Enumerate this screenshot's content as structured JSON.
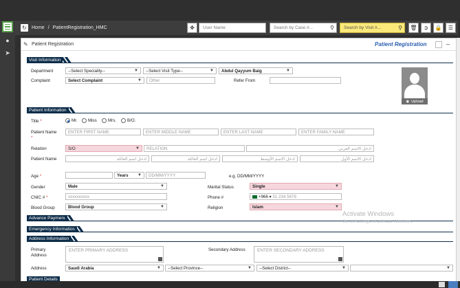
{
  "topbar": {
    "breadcrumb_home": "Home",
    "breadcrumb_sep": "/",
    "breadcrumb_current": "PatientRegistration_HMC",
    "user_name_placeholder": "User Name",
    "search_case_placeholder": "Search by Case #...",
    "search_visit_placeholder": "Search by Visit #..."
  },
  "page": {
    "title": "Patient Registration",
    "title_right": "Patient Registration"
  },
  "sections": {
    "visit": "Visit Information",
    "patient": "Patient Information",
    "advance": "Advance Payment",
    "emergency": "Emergency Information",
    "address": "Address Information",
    "patient_details": "Patient Details"
  },
  "visit": {
    "department_label": "Department",
    "speciality": "--Select Speciality--",
    "visit_type": "--Select Visit Type--",
    "doctor": "Abdul Qayyum Baig",
    "complaint_label": "Complaint",
    "complaint": "Select Complaint",
    "other_placeholder": "Other",
    "refer_label": "Refer From"
  },
  "patient": {
    "title_label": "Title",
    "titles": [
      "Mr.",
      "Miss",
      "Mrs.",
      "B/O."
    ],
    "name_label": "Patient Name",
    "first_ph": "ENTER FIRST NAME",
    "middle_ph": "ENTER MIDDLE NAME",
    "last_ph": "ENTER LAST NAME",
    "family_ph": "ENTER FAMILY NAME",
    "relation_label": "Relation",
    "relation": "S/O",
    "relation_ph": "RELATION",
    "relation_ar_ph": "ادخل الاسم العربي",
    "name_ar_label": "Patient Name",
    "ar_family_ph": "ادخل اسم العائلة",
    "ar_last_ph": "ادخل اسم العائلة",
    "ar_middle_ph": "ادخل الاسم الأوسط",
    "ar_first_ph": "ادخل الاسم الأول",
    "ar_rel_ph": "ادخل اسم العائلة",
    "age_label": "Age",
    "age_unit": "Years",
    "dob_ph": "DD/MM/YYYY",
    "dob_hint": "e.g. DD/MM/YYYY",
    "gender_label": "Gender",
    "gender": "Male",
    "marital_label": "Marital Status",
    "marital": "Single",
    "cnic_label": "CNIC #",
    "cnic_ph": "xxxxxxxxxx",
    "phone_label": "Phone #",
    "phone_code": "+966",
    "phone_ph": "51 234 5678",
    "blood_label": "Blood Group",
    "blood": "Blood Group",
    "religion_label": "Religion",
    "religion": "Islam"
  },
  "address": {
    "primary_label": "Primary Address",
    "primary_ph": "ENTER PRIMARY ADDRESS",
    "secondary_label": "Secondary Address",
    "secondary_ph": "ENTER SECONDARY ADDRESS",
    "address_label": "Address",
    "country": "Saudi Arabia",
    "province": "--Select Province--",
    "district": "--Select District--"
  },
  "watermark": {
    "line1": "Activate Windows",
    "line2": "Go to Settings to activate Windows."
  },
  "upload_label": "Upload"
}
